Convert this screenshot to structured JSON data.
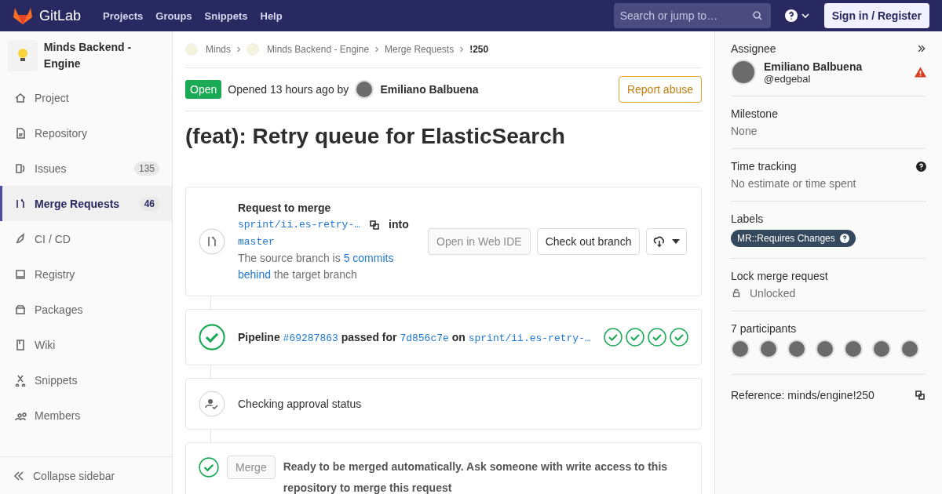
{
  "navbar": {
    "logo": "GitLab",
    "links": [
      "Projects",
      "Groups",
      "Snippets",
      "Help"
    ],
    "search": {
      "placeholder": "Search or jump to…"
    },
    "sign_in": "Sign in / Register"
  },
  "sidebar": {
    "project": "Minds Backend - Engine",
    "items": [
      {
        "label": "Project",
        "kind": "home",
        "selected": false
      },
      {
        "label": "Repository",
        "kind": "doc",
        "selected": false
      },
      {
        "label": "Issues",
        "kind": "issues",
        "count": "135",
        "selected": false
      },
      {
        "label": "Merge Requests",
        "kind": "merge",
        "count": "46",
        "selected": true
      },
      {
        "label": "CI / CD",
        "kind": "rocket",
        "selected": false
      },
      {
        "label": "Registry",
        "kind": "registry",
        "selected": false
      },
      {
        "label": "Packages",
        "kind": "package",
        "selected": false
      },
      {
        "label": "Wiki",
        "kind": "book",
        "selected": false
      },
      {
        "label": "Snippets",
        "kind": "scissors",
        "selected": false
      },
      {
        "label": "Members",
        "kind": "users",
        "selected": false
      }
    ],
    "collapse": "Collapse sidebar"
  },
  "breadcrumbs": [
    {
      "label": "Minds",
      "kind": "group"
    },
    {
      "label": "Minds Backend - Engine",
      "kind": "group"
    },
    {
      "label": "Merge Requests",
      "kind": "link"
    },
    {
      "label": "!250",
      "kind": "current"
    }
  ],
  "header": {
    "status": "Open",
    "opened": "Opened 13 hours ago by",
    "author": "Emiliano Balbuena",
    "report": "Report abuse"
  },
  "title": "(feat): Retry queue for ElasticSearch",
  "request": {
    "heading": "Request to merge",
    "source_branch": "sprint/ii.es-retry-…",
    "into": "into",
    "target_branch": "master",
    "behind_before": "The source branch is",
    "behind_link": "5 commits",
    "behind_link2": "behind",
    "behind_after": "the target branch",
    "buttons": [
      {
        "label": "Open in Web IDE",
        "disabled": true
      },
      {
        "label": "Check out branch",
        "disabled": false
      }
    ]
  },
  "pipeline": {
    "label": "Pipeline",
    "id": "#69287863",
    "passed": "passed for",
    "commit": "7d856c7e",
    "on": "on",
    "branch": "sprint/ii.es-retry-…",
    "stages": [
      {
        "kind": "success"
      },
      {
        "kind": "success"
      },
      {
        "kind": "success"
      },
      {
        "kind": "success"
      }
    ]
  },
  "approval": {
    "text": "Checking approval status"
  },
  "merge": {
    "button": "Merge",
    "message": "Ready to be merged automatically. Ask someone with write access to this repository to merge this request"
  },
  "right": {
    "assignee": {
      "label": "Assignee",
      "name": "Emiliano Balbuena",
      "username": "@edgebal"
    },
    "milestone": {
      "label": "Milestone",
      "value": "None"
    },
    "time_tracking": {
      "label": "Time tracking",
      "value": "No estimate or time spent"
    },
    "labels": {
      "label": "Labels",
      "items": [
        {
          "text": "MR::Requires Changes",
          "color": "#34495e"
        }
      ]
    },
    "lock": {
      "label": "Lock merge request",
      "value": "Unlocked"
    },
    "participants": {
      "label": "7 participants",
      "people": [
        {
          "kind": "photo"
        },
        {
          "kind": "photo"
        },
        {
          "kind": "photo"
        },
        {
          "kind": "photo"
        },
        {
          "kind": "photo"
        },
        {
          "kind": "photo"
        },
        {
          "kind": "photo"
        }
      ]
    },
    "reference": "Reference: minds/engine!250"
  }
}
